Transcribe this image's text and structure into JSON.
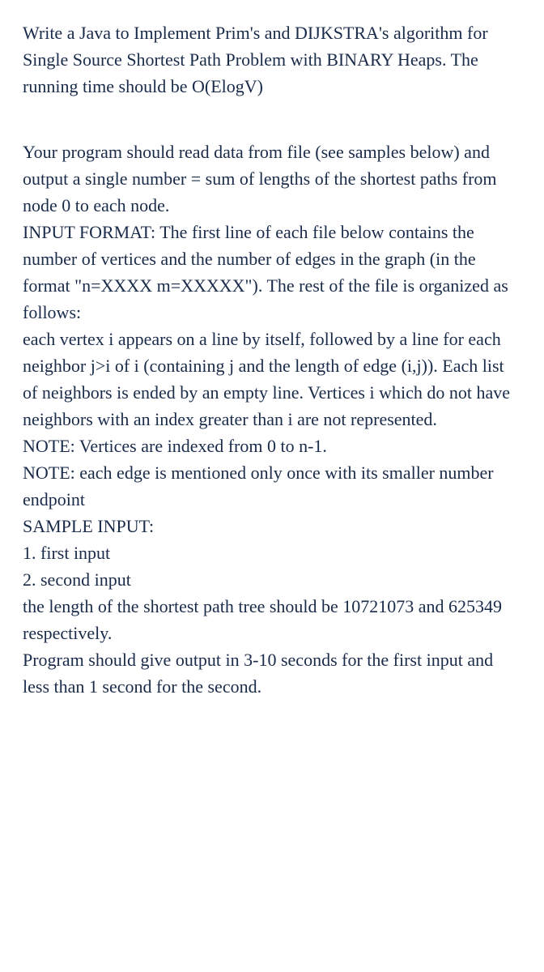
{
  "content": {
    "intro": "Write a Java to Implement Prim's and DIJKSTRA's algorithm for Single Source Shortest Path Problem with BINARY Heaps. The running time should be O(ElogV)",
    "description": "Your program should read data from file (see samples below) and output a single number = sum of lengths of the shortest paths from node 0 to each node.",
    "inputFormat": "INPUT FORMAT: The first line of each file below contains the number of vertices and the number of edges in the graph (in the format \"n=XXXX m=XXXXX\"). The rest of the file is organized as follows:",
    "vertexDescription": "each vertex i appears on a line by itself, followed by a line for each neighbor j>i of i (containing j and the length of edge (i,j)). Each list of neighbors is ended by an empty line. Vertices i which do not have neighbors with an index greater than i are not represented.",
    "note1": "NOTE: Vertices are indexed from 0 to n-1.",
    "note2": "NOTE: each edge is mentioned only once with its smaller number endpoint",
    "sampleHeader": "SAMPLE INPUT:",
    "sample1": "1. first input",
    "sample2": "2. second input",
    "expectedOutput": "the length of the shortest path tree should be 10721073 and 625349 respectively.",
    "timing": "Program should give output in 3-10 seconds for the first input and less than 1 second for the second."
  }
}
